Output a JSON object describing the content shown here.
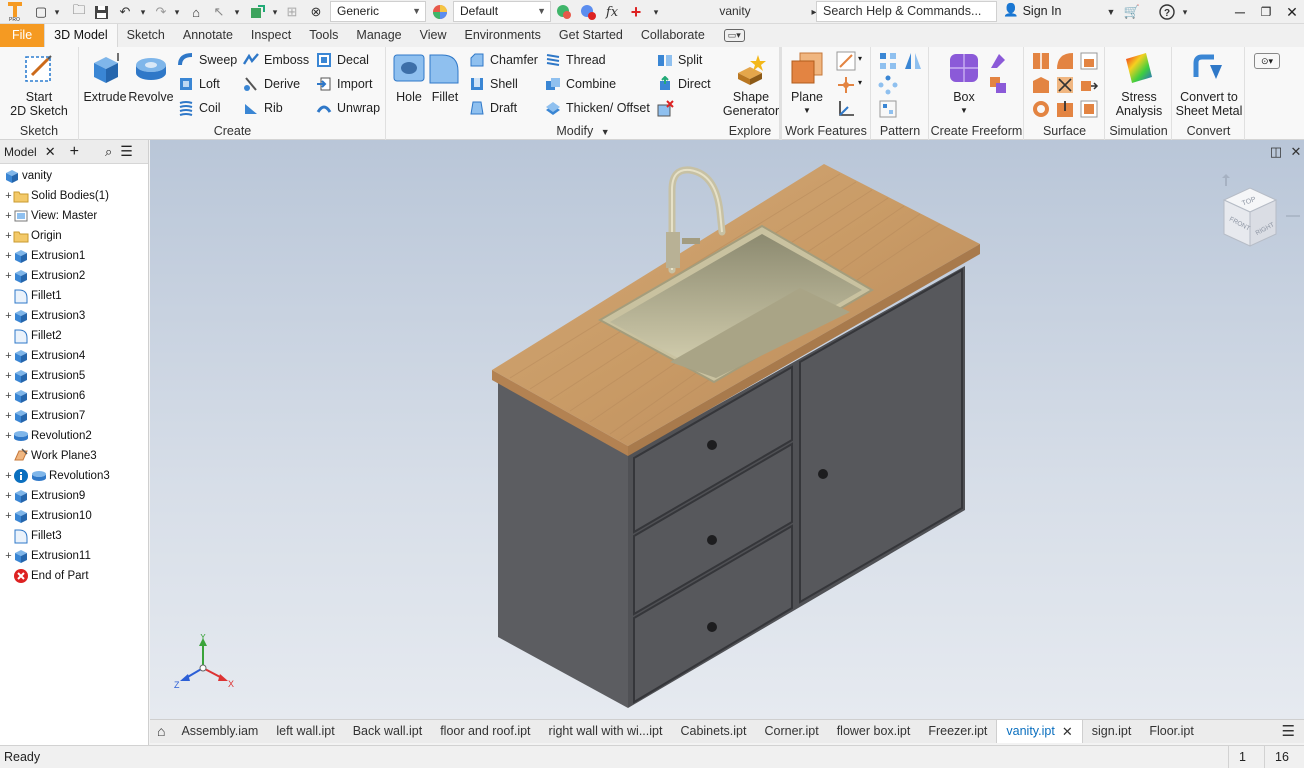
{
  "quick_access": {
    "material": "Generic",
    "appearance": "Default",
    "document_title": "vanity",
    "search_placeholder": "Search Help & Commands...",
    "sign_in": "Sign In"
  },
  "ribbon_tabs": [
    "File",
    "3D Model",
    "Sketch",
    "Annotate",
    "Inspect",
    "Tools",
    "Manage",
    "View",
    "Environments",
    "Get Started",
    "Collaborate"
  ],
  "active_tab": "3D Model",
  "ribbon": {
    "sketch": {
      "title": "Sketch",
      "start_sketch": "Start\n2D Sketch"
    },
    "create": {
      "title": "Create",
      "extrude": "Extrude",
      "revolve": "Revolve",
      "sweep": "Sweep",
      "loft": "Loft",
      "coil": "Coil",
      "emboss": "Emboss",
      "derive": "Derive",
      "rib": "Rib",
      "decal": "Decal",
      "import": "Import",
      "unwrap": "Unwrap"
    },
    "modify": {
      "title": "Modify",
      "hole": "Hole",
      "fillet": "Fillet",
      "chamfer": "Chamfer",
      "shell": "Shell",
      "draft": "Draft",
      "thread": "Thread",
      "combine": "Combine",
      "thicken": "Thicken/ Offset",
      "split": "Split",
      "direct": "Direct"
    },
    "explore": {
      "title": "Explore",
      "shape_generator": "Shape\nGenerator"
    },
    "work_features": {
      "title": "Work Features",
      "plane": "Plane"
    },
    "pattern": {
      "title": "Pattern"
    },
    "freeform": {
      "title": "Create Freeform",
      "box": "Box"
    },
    "surface": {
      "title": "Surface"
    },
    "simulation": {
      "title": "Simulation",
      "stress": "Stress\nAnalysis"
    },
    "convert": {
      "title": "Convert",
      "sheet_metal": "Convert to\nSheet Metal"
    }
  },
  "browser": {
    "title": "Model",
    "items": [
      {
        "label": "vanity",
        "icon": "part-icon",
        "level": 0,
        "expand": ""
      },
      {
        "label": "Solid Bodies(1)",
        "icon": "folder-icon",
        "level": 1,
        "expand": "+"
      },
      {
        "label": "View: Master",
        "icon": "view-icon",
        "level": 1,
        "expand": "+"
      },
      {
        "label": "Origin",
        "icon": "folder-icon",
        "level": 1,
        "expand": "+"
      },
      {
        "label": "Extrusion1",
        "icon": "extrude-icon",
        "level": 1,
        "expand": "+"
      },
      {
        "label": "Extrusion2",
        "icon": "extrude-icon",
        "level": 1,
        "expand": "+"
      },
      {
        "label": "Fillet1",
        "icon": "fillet-icon",
        "level": 1,
        "expand": ""
      },
      {
        "label": "Extrusion3",
        "icon": "extrude-icon",
        "level": 1,
        "expand": "+"
      },
      {
        "label": "Fillet2",
        "icon": "fillet-icon",
        "level": 1,
        "expand": ""
      },
      {
        "label": "Extrusion4",
        "icon": "extrude-icon",
        "level": 1,
        "expand": "+"
      },
      {
        "label": "Extrusion5",
        "icon": "extrude-icon",
        "level": 1,
        "expand": "+"
      },
      {
        "label": "Extrusion6",
        "icon": "extrude-icon",
        "level": 1,
        "expand": "+"
      },
      {
        "label": "Extrusion7",
        "icon": "extrude-icon",
        "level": 1,
        "expand": "+"
      },
      {
        "label": "Revolution2",
        "icon": "revolve-icon",
        "level": 1,
        "expand": "+"
      },
      {
        "label": "Work Plane3",
        "icon": "workplane-icon",
        "level": 1,
        "expand": ""
      },
      {
        "label": "Revolution3",
        "icon": "revolve-icon",
        "level": 1,
        "expand": "+",
        "info": true
      },
      {
        "label": "Extrusion9",
        "icon": "extrude-icon",
        "level": 1,
        "expand": "+"
      },
      {
        "label": "Extrusion10",
        "icon": "extrude-icon",
        "level": 1,
        "expand": "+"
      },
      {
        "label": "Fillet3",
        "icon": "fillet-icon",
        "level": 1,
        "expand": ""
      },
      {
        "label": "Extrusion11",
        "icon": "extrude-icon",
        "level": 1,
        "expand": "+"
      },
      {
        "label": "End of Part",
        "icon": "end-of-part-icon",
        "level": 1,
        "expand": ""
      }
    ]
  },
  "view_cube": {
    "top": "TOP",
    "front": "FRONT",
    "right": "RIGHT"
  },
  "triad": {
    "x": "X",
    "y": "Y",
    "z": "Z"
  },
  "document_tabs": [
    "Assembly.iam",
    "left wall.ipt",
    "Back wall.ipt",
    "floor and roof.ipt",
    "right wall with wi...ipt",
    "Cabinets.ipt",
    "Corner.ipt",
    "flower box.ipt",
    "Freezer.ipt",
    "vanity.ipt",
    "sign.ipt",
    "Floor.ipt"
  ],
  "active_document": "vanity.ipt",
  "status": {
    "text": "Ready",
    "count1": "1",
    "count2": "16"
  },
  "colors": {
    "file_tab": "#f59a22",
    "accent_blue": "#0a6fbf",
    "cabinet": "#5a5b5e",
    "countertop": "#c99b66",
    "viewport_top": "#b9c6d8"
  }
}
